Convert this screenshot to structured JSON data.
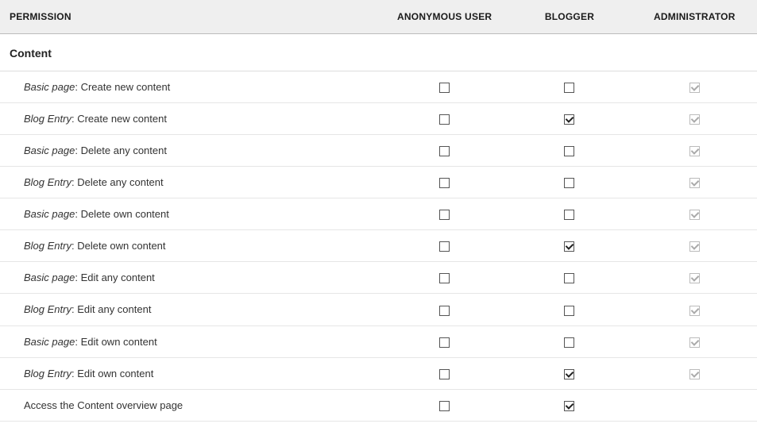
{
  "headers": {
    "permission": "Permission",
    "roles": [
      "Anonymous user",
      "Blogger",
      "Administrator"
    ]
  },
  "section": {
    "title": "Content",
    "permissions": [
      {
        "type": "Basic page",
        "action": "Create new content",
        "checks": [
          false,
          false,
          true
        ],
        "disabled": [
          false,
          false,
          true
        ]
      },
      {
        "type": "Blog Entry",
        "action": "Create new content",
        "checks": [
          false,
          true,
          true
        ],
        "disabled": [
          false,
          false,
          true
        ]
      },
      {
        "type": "Basic page",
        "action": "Delete any content",
        "checks": [
          false,
          false,
          true
        ],
        "disabled": [
          false,
          false,
          true
        ]
      },
      {
        "type": "Blog Entry",
        "action": "Delete any content",
        "checks": [
          false,
          false,
          true
        ],
        "disabled": [
          false,
          false,
          true
        ]
      },
      {
        "type": "Basic page",
        "action": "Delete own content",
        "checks": [
          false,
          false,
          true
        ],
        "disabled": [
          false,
          false,
          true
        ]
      },
      {
        "type": "Blog Entry",
        "action": "Delete own content",
        "checks": [
          false,
          true,
          true
        ],
        "disabled": [
          false,
          false,
          true
        ]
      },
      {
        "type": "Basic page",
        "action": "Edit any content",
        "checks": [
          false,
          false,
          true
        ],
        "disabled": [
          false,
          false,
          true
        ]
      },
      {
        "type": "Blog Entry",
        "action": "Edit any content",
        "checks": [
          false,
          false,
          true
        ],
        "disabled": [
          false,
          false,
          true
        ]
      },
      {
        "type": "Basic page",
        "action": "Edit own content",
        "checks": [
          false,
          false,
          true
        ],
        "disabled": [
          false,
          false,
          true
        ]
      },
      {
        "type": "Blog Entry",
        "action": "Edit own content",
        "checks": [
          false,
          true,
          true
        ],
        "disabled": [
          false,
          false,
          true
        ]
      },
      {
        "type": null,
        "action": "Access the Content overview page",
        "checks": [
          false,
          true,
          null
        ],
        "disabled": [
          false,
          false,
          true
        ]
      }
    ]
  }
}
